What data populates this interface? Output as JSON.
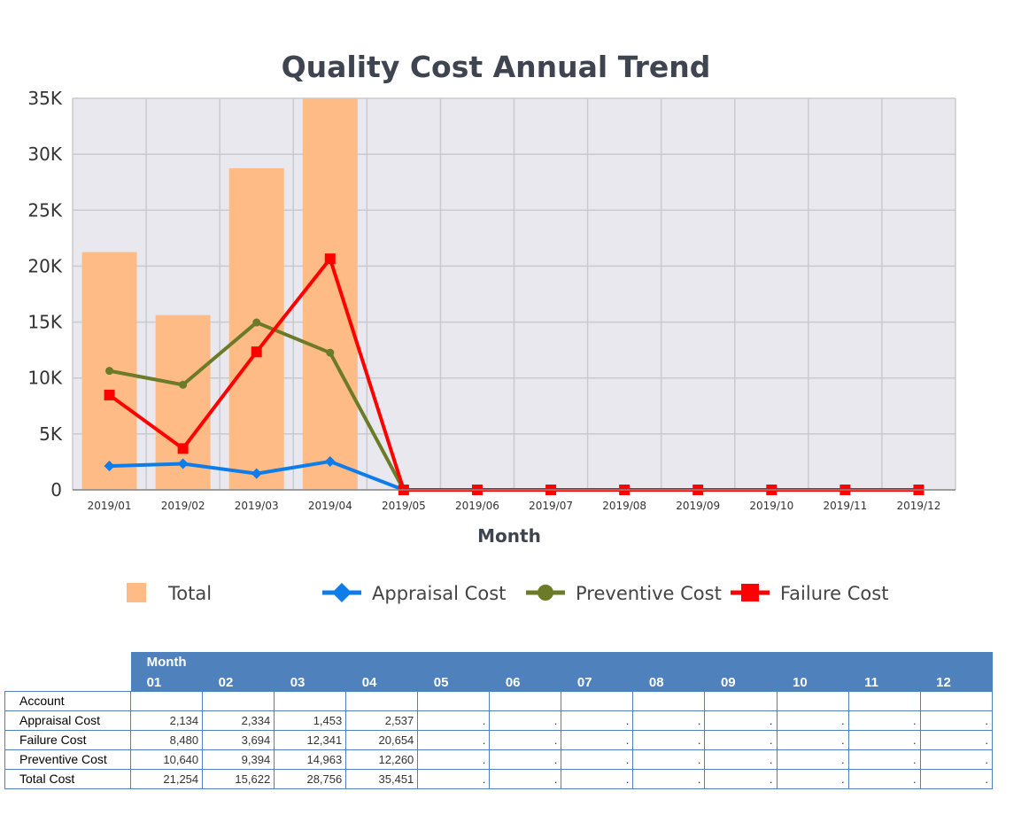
{
  "chart_data": {
    "type": "bar",
    "title": "Quality Cost Annual Trend",
    "xlabel": "Month",
    "ylabel": "",
    "ylim": [
      0,
      35000
    ],
    "yticks": [
      "0",
      "5K",
      "10K",
      "15K",
      "20K",
      "25K",
      "30K",
      "35K"
    ],
    "grid": true,
    "legend_position": "bottom",
    "categories": [
      "2019/01",
      "2019/02",
      "2019/03",
      "2019/04",
      "2019/05",
      "2019/06",
      "2019/07",
      "2019/08",
      "2019/09",
      "2019/10",
      "2019/11",
      "2019/12"
    ],
    "series": [
      {
        "name": "Total",
        "kind": "bar",
        "color": "#ffbb85",
        "values": [
          21254,
          15622,
          28756,
          35151,
          0,
          0,
          0,
          0,
          0,
          0,
          0,
          0
        ]
      },
      {
        "name": "Appraisal Cost",
        "kind": "line",
        "marker": "diamond",
        "color": "#0f7de9",
        "values": [
          2134,
          2334,
          1453,
          2537,
          0,
          0,
          0,
          0,
          0,
          0,
          0,
          0
        ]
      },
      {
        "name": "Preventive Cost",
        "kind": "line",
        "marker": "circle",
        "color": "#6b7b27",
        "values": [
          10640,
          9394,
          14963,
          12260,
          0,
          0,
          0,
          0,
          0,
          0,
          0,
          0
        ]
      },
      {
        "name": "Failure Cost",
        "kind": "line",
        "marker": "square",
        "color": "#ff0000",
        "values": [
          8480,
          3694,
          12341,
          20654,
          0,
          0,
          0,
          0,
          0,
          0,
          0,
          0
        ]
      }
    ]
  },
  "table": {
    "group_header": "Month",
    "months": [
      "01",
      "02",
      "03",
      "04",
      "05",
      "06",
      "07",
      "08",
      "09",
      "10",
      "11",
      "12"
    ],
    "rows": [
      {
        "label": "Account",
        "cells": [
          "",
          "",
          "",
          "",
          "",
          "",
          "",
          "",
          "",
          "",
          "",
          ""
        ]
      },
      {
        "label": "Appraisal Cost",
        "cells": [
          "2,134",
          "2,334",
          "1,453",
          "2,537",
          ".",
          ".",
          ".",
          ".",
          ".",
          ".",
          ".",
          "."
        ]
      },
      {
        "label": "Failure Cost",
        "cells": [
          "8,480",
          "3,694",
          "12,341",
          "20,654",
          ".",
          ".",
          ".",
          ".",
          ".",
          ".",
          ".",
          "."
        ]
      },
      {
        "label": "Preventive Cost",
        "cells": [
          "10,640",
          "9,394",
          "14,963",
          "12,260",
          ".",
          ".",
          ".",
          ".",
          ".",
          ".",
          ".",
          "."
        ]
      },
      {
        "label": "Total Cost",
        "cells": [
          "21,254",
          "15,622",
          "28,756",
          "35,451",
          ".",
          ".",
          ".",
          ".",
          ".",
          ".",
          ".",
          "."
        ]
      }
    ]
  }
}
